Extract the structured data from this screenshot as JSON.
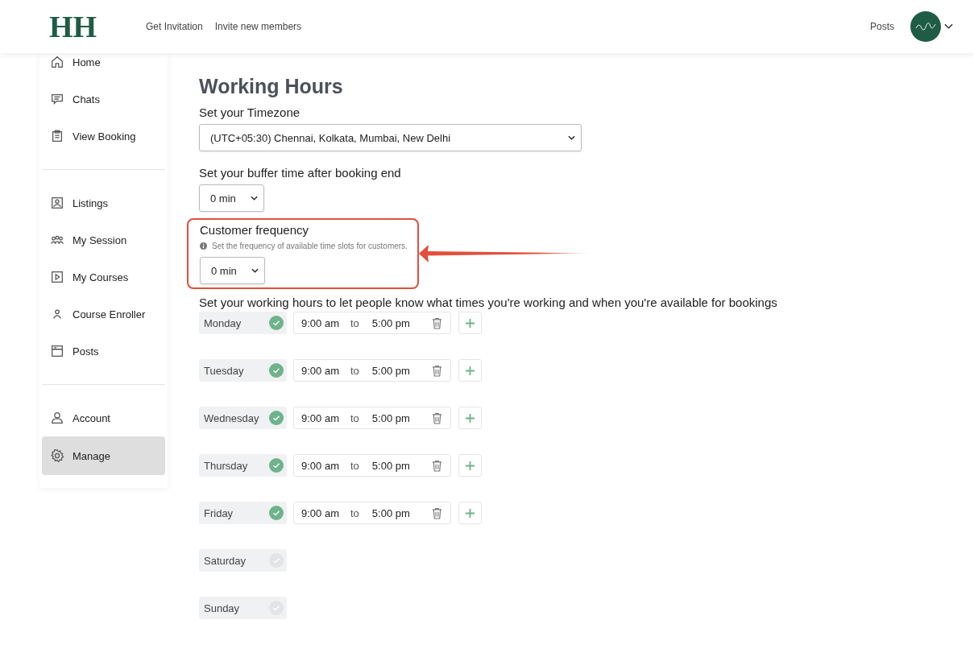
{
  "header": {
    "logo": "HH",
    "links": [
      "Get Invitation",
      "Invite new members"
    ],
    "right_link": "Posts"
  },
  "sidebar": {
    "groups": [
      [
        {
          "label": "Home",
          "selected": false
        },
        {
          "label": "Chats",
          "selected": false
        },
        {
          "label": "View Booking",
          "selected": false
        }
      ],
      [
        {
          "label": "Listings",
          "selected": false
        },
        {
          "label": "My Session",
          "selected": false
        },
        {
          "label": "My Courses",
          "selected": false
        },
        {
          "label": "Course Enroller",
          "selected": false
        },
        {
          "label": "Posts",
          "selected": false
        }
      ],
      [
        {
          "label": "Account",
          "selected": false
        },
        {
          "label": "Manage",
          "selected": true
        }
      ]
    ]
  },
  "main": {
    "title": "Working Hours",
    "timezone": {
      "label": "Set your Timezone",
      "value": "(UTC+05:30) Chennai, Kolkata, Mumbai, New Delhi"
    },
    "buffer": {
      "label": "Set your buffer time after booking end",
      "value": "0 min"
    },
    "frequency": {
      "label": "Customer frequency",
      "hint": "Set the frequency of available time slots for customers.",
      "value": "0 min",
      "highlighted": true
    },
    "hours_label": "Set your working hours to let people know what times you're working and when you're available for bookings",
    "days": [
      {
        "name": "Monday",
        "enabled": true,
        "from": "9:00 am",
        "sep": "to",
        "to": "5:00 pm"
      },
      {
        "name": "Tuesday",
        "enabled": true,
        "from": "9:00 am",
        "sep": "to",
        "to": "5:00 pm"
      },
      {
        "name": "Wednesday",
        "enabled": true,
        "from": "9:00 am",
        "sep": "to",
        "to": "5:00 pm"
      },
      {
        "name": "Thursday",
        "enabled": true,
        "from": "9:00 am",
        "sep": "to",
        "to": "5:00 pm"
      },
      {
        "name": "Friday",
        "enabled": true,
        "from": "9:00 am",
        "sep": "to",
        "to": "5:00 pm"
      },
      {
        "name": "Saturday",
        "enabled": false
      },
      {
        "name": "Sunday",
        "enabled": false
      }
    ]
  }
}
